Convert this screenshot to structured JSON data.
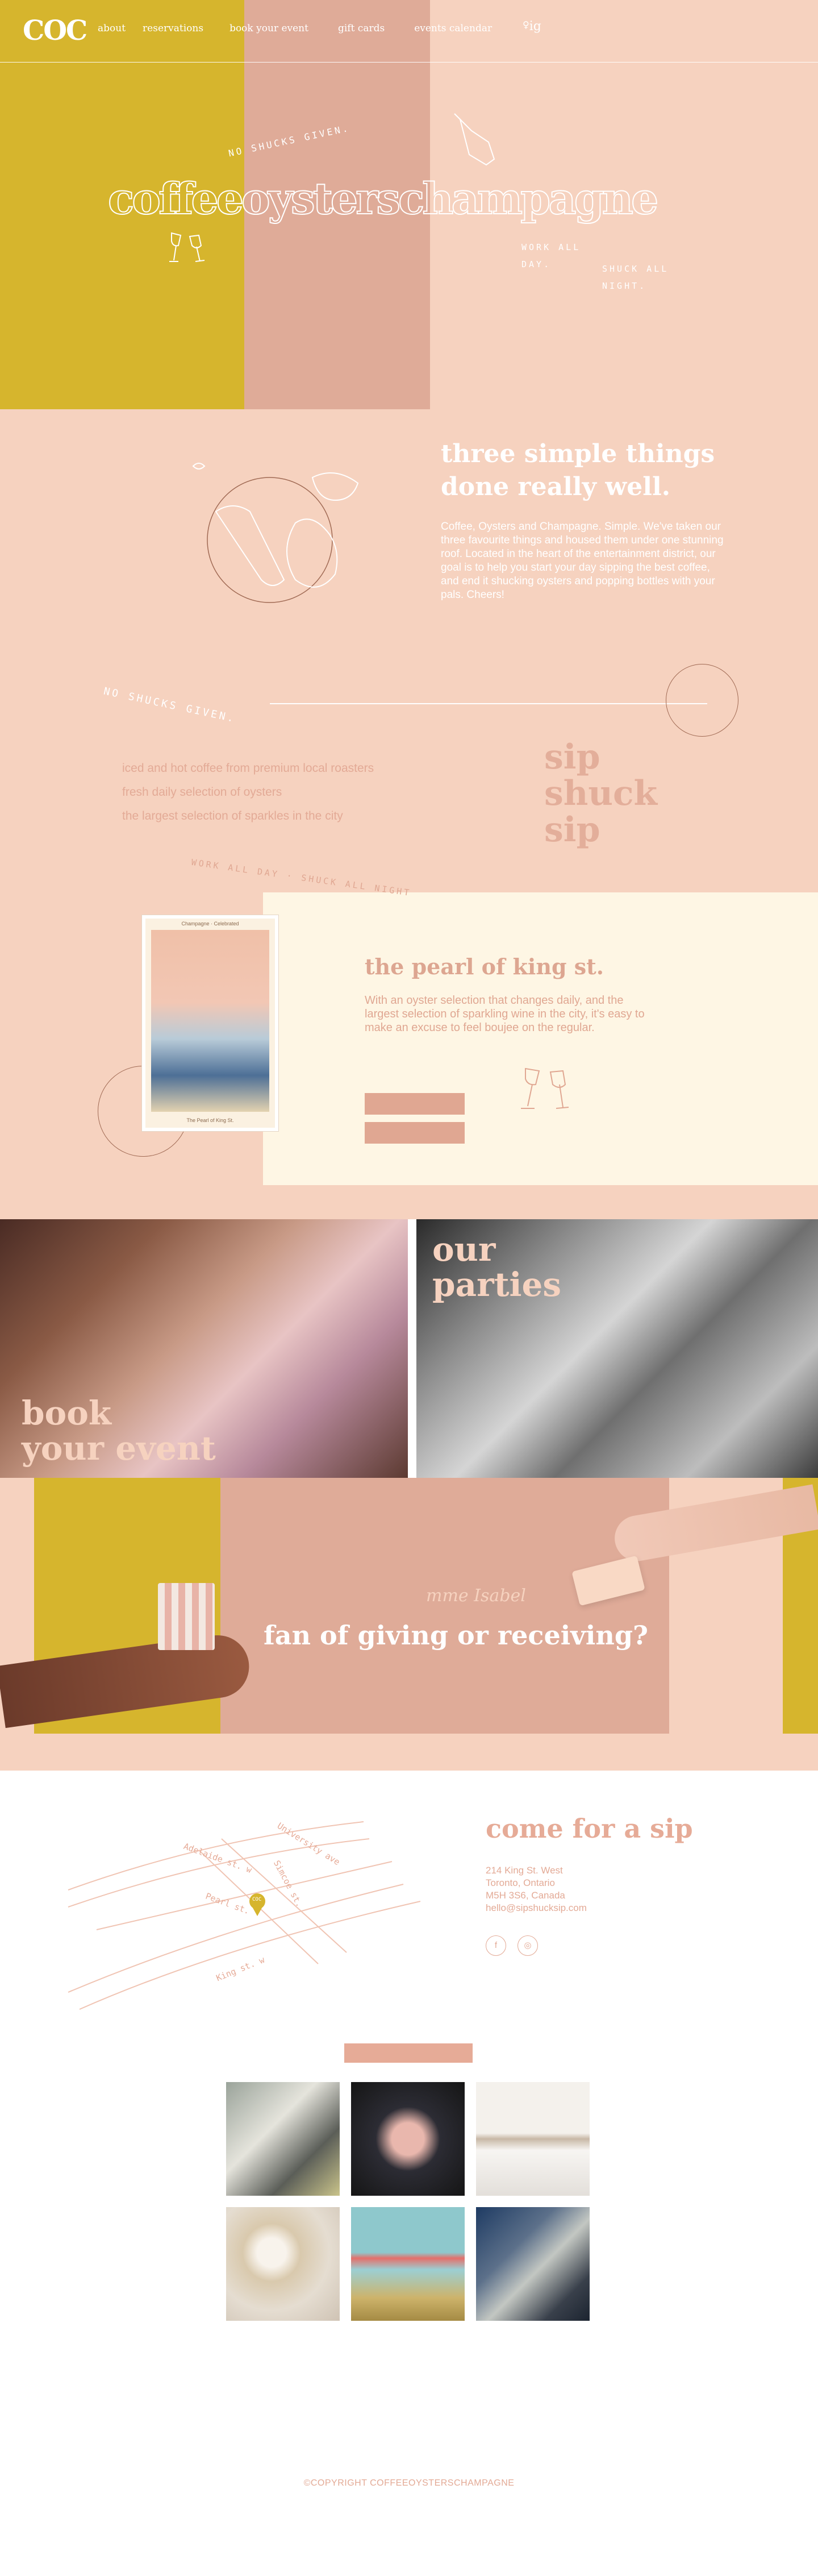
{
  "brand": {
    "logo_text": "COC"
  },
  "nav": {
    "items": [
      "about",
      "reservations",
      "book your event",
      "gift cards",
      "events calendar"
    ],
    "instagram_label": "ig"
  },
  "hero": {
    "title": "coffeeoysterschampagne",
    "tagline_top": "No shucks given.",
    "tagline_work": "Work all day.",
    "tagline_shuck": "Shuck all night."
  },
  "intro": {
    "title": "three simple things done really well.",
    "body": "Coffee, Oysters and Champagne. Simple. We've taken our three favourite things and housed them under one stunning roof. Located in the heart of the entertainment district, our goal is to help you start your day sipping the best coffee, and end it shucking oysters and popping bottles with your pals. Cheers!",
    "tag": "No shucks given.",
    "features": [
      "iced and hot coffee from premium local roasters",
      "fresh daily selection of oysters",
      "the largest selection of sparkles in the city"
    ],
    "stack": [
      "sip",
      "shuck",
      "sip"
    ]
  },
  "pearl": {
    "arc_text": "Work all day · Shuck all night",
    "poster_top": "Champagne · Celebrated",
    "poster_caption": "The Pearl of King St.",
    "title": "the pearl of king st.",
    "body": "With an oyster selection that changes daily, and the largest selection of sparkling wine in the city, it's easy to make an excuse to feel boujee on the regular."
  },
  "panels": {
    "left_label": [
      "book",
      "your event"
    ],
    "right_label": [
      "our",
      "parties"
    ]
  },
  "gift": {
    "script": "mme Isabel",
    "title": "fan of giving or receiving?"
  },
  "contact": {
    "title": "come for a sip",
    "address": [
      "214 King St. West",
      "Toronto, Ontario",
      "M5H 3S6, Canada",
      "hello@sipshucksip.com"
    ],
    "social": [
      "f",
      "◎"
    ],
    "map_labels": {
      "university": "University ave",
      "adelaide": "Adelaide st. w",
      "simcoe": "Simcoe st.",
      "pearl": "Pearl st.",
      "king": "King st. w",
      "pin": "COC"
    }
  },
  "gallery": {
    "tiles": [
      "oysters-plate",
      "champagne-toast",
      "oyster-bar-shelf",
      "coffee-cups",
      "drinking-bottle",
      "oyster-spread"
    ]
  },
  "footer": {
    "copyright": "©COPYRIGHT COFFEEOYSTERSCHAMPAGNE"
  },
  "colors": {
    "blush": "#f6d2bf",
    "mustard": "#d6b52d",
    "rose": "#dfab98",
    "cream": "#fef6e4",
    "accent_text": "#e3aa96"
  }
}
